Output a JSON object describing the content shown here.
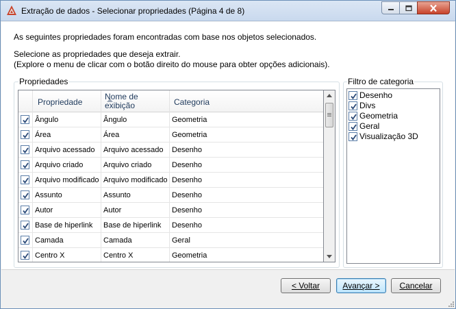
{
  "window": {
    "title": "Extração de dados - Selecionar propriedades (Página 4 de 8)",
    "accent": "#c8432b"
  },
  "content": {
    "line1": "As seguintes propriedades foram encontradas com base nos objetos selecionados.",
    "line2": "Selecione as propriedades que deseja extrair.",
    "line3": "(Explore o menu de clicar com o botão direito do mouse para obter opções adicionais)."
  },
  "properties": {
    "group_label": "Propriedades",
    "headers": {
      "property": "Propriedade",
      "display_name_1": "Nome de",
      "display_name_2": "exibição",
      "category": "Categoria"
    },
    "rows": [
      {
        "checked": true,
        "property": "Ângulo",
        "display": "Ângulo",
        "category": "Geometria"
      },
      {
        "checked": true,
        "property": "Área",
        "display": "Área",
        "category": "Geometria"
      },
      {
        "checked": true,
        "property": "Arquivo acessado",
        "display": "Arquivo acessado",
        "category": "Desenho"
      },
      {
        "checked": true,
        "property": "Arquivo criado",
        "display": "Arquivo criado",
        "category": "Desenho"
      },
      {
        "checked": true,
        "property": "Arquivo modificado",
        "display": "Arquivo modificado",
        "category": "Desenho"
      },
      {
        "checked": true,
        "property": "Assunto",
        "display": "Assunto",
        "category": "Desenho"
      },
      {
        "checked": true,
        "property": "Autor",
        "display": "Autor",
        "category": "Desenho"
      },
      {
        "checked": true,
        "property": "Base de hiperlink",
        "display": "Base de hiperlink",
        "category": "Desenho"
      },
      {
        "checked": true,
        "property": "Camada",
        "display": "Camada",
        "category": "Geral"
      },
      {
        "checked": true,
        "property": "Centro X",
        "display": "Centro X",
        "category": "Geometria"
      }
    ]
  },
  "category_filter": {
    "group_label": "Filtro de categoria",
    "items": [
      {
        "checked": true,
        "label": "Desenho"
      },
      {
        "checked": true,
        "label": "Divs"
      },
      {
        "checked": true,
        "label": "Geometria"
      },
      {
        "checked": true,
        "label": "Geral"
      },
      {
        "checked": true,
        "label": "Visualização 3D"
      }
    ]
  },
  "buttons": {
    "back": "< Voltar",
    "next": "Avançar >",
    "cancel": "Cancelar"
  }
}
